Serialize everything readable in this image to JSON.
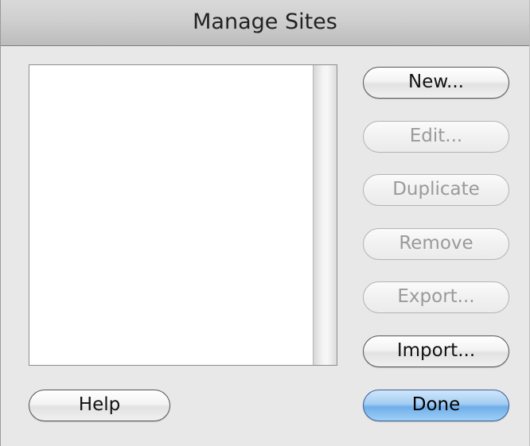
{
  "window": {
    "title": "Manage Sites"
  },
  "sites_list": {
    "items": []
  },
  "buttons": {
    "new": "New...",
    "edit": "Edit...",
    "duplicate": "Duplicate",
    "remove": "Remove",
    "export": "Export...",
    "import": "Import...",
    "help": "Help",
    "done": "Done"
  },
  "states": {
    "edit_enabled": false,
    "duplicate_enabled": false,
    "remove_enabled": false,
    "export_enabled": false
  },
  "colors": {
    "default_button": "#8ec3f2",
    "window_background": "#e8e8e8"
  }
}
